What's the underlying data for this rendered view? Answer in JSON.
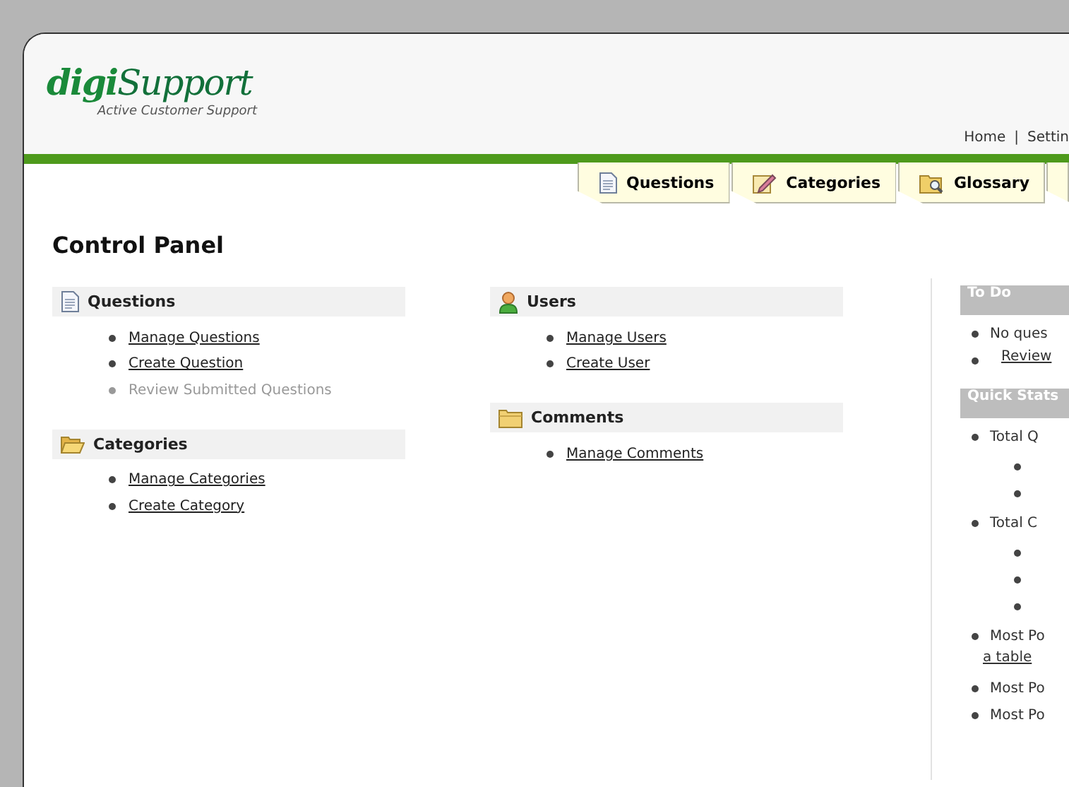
{
  "logo": {
    "bold": "digi",
    "rest": "Support",
    "tagline": "Active Customer Support"
  },
  "nav": [
    "Home",
    "|",
    "Settin"
  ],
  "tabs": [
    {
      "label": "Questions",
      "selected": false
    },
    {
      "label": "Categories",
      "selected": false
    },
    {
      "label": "Glossary",
      "selected": false
    },
    {
      "selected": false
    }
  ],
  "title": "Control Panel",
  "columns": [
    [
      {
        "title": "Questions",
        "links": [
          {
            "text": "Manage Questions",
            "disabled": false
          },
          {
            "text": "Create Question",
            "disabled": false
          },
          {
            "text": "Review Submitted Questions",
            "disabled": true
          }
        ]
      },
      {
        "title": "Categories",
        "links": [
          {
            "text": "Manage Categories",
            "disabled": false
          },
          {
            "text": "Create Category",
            "disabled": false
          }
        ]
      }
    ],
    [
      {
        "title": "Users",
        "links": [
          {
            "text": "Manage Users",
            "disabled": false
          },
          {
            "text": "Create User",
            "disabled": false
          }
        ]
      },
      {
        "title": "Comments",
        "links": [
          {
            "text": "Manage Comments",
            "disabled": false
          }
        ]
      }
    ]
  ],
  "sidebar": [
    {
      "title": "To Do",
      "items": [
        {
          "kind": "text",
          "text": "No ques"
        },
        {
          "kind": "link",
          "text": "Review"
        }
      ]
    },
    {
      "title": "Quick Stats",
      "items": [
        {
          "kind": "text",
          "text": "Total Q",
          "children": [
            {
              "kind": "bullet"
            },
            {
              "kind": "bullet"
            }
          ]
        },
        {
          "kind": "text",
          "text": "Total C",
          "children": [
            {
              "kind": "bullet"
            },
            {
              "kind": "bullet"
            },
            {
              "kind": "bullet"
            }
          ]
        },
        {
          "kind": "text",
          "text": "Most Po",
          "link": "a table"
        },
        {
          "kind": "text",
          "text": "Most Po"
        },
        {
          "kind": "text",
          "text": "Most Po"
        }
      ]
    }
  ]
}
